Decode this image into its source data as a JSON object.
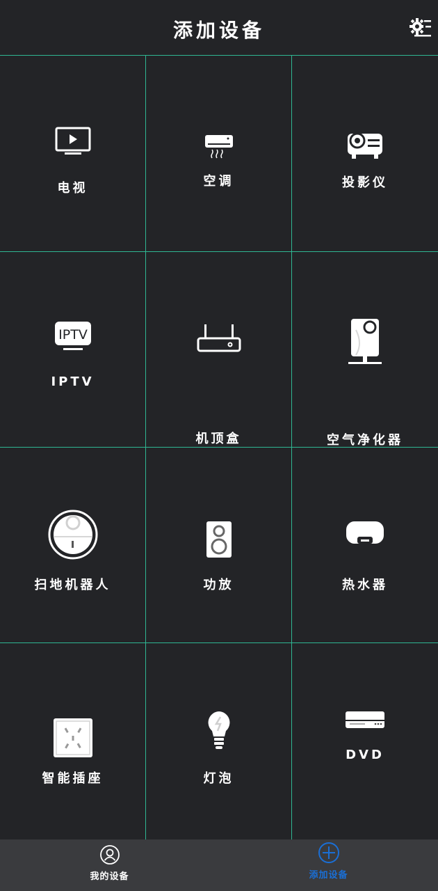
{
  "header": {
    "title": "添加设备",
    "settings_icon": "gear-list-icon"
  },
  "devices": [
    {
      "label": "电视",
      "icon": "tv-icon"
    },
    {
      "label": "空调",
      "icon": "air-conditioner-icon"
    },
    {
      "label": "投影仪",
      "icon": "projector-icon"
    },
    {
      "label": "IPTV",
      "icon": "iptv-icon"
    },
    {
      "label": "机顶盒",
      "icon": "set-top-box-icon"
    },
    {
      "label": "空气净化器",
      "icon": "air-purifier-icon"
    },
    {
      "label": "扫地机器人",
      "icon": "robot-vacuum-icon"
    },
    {
      "label": "功放",
      "icon": "speaker-icon"
    },
    {
      "label": "热水器",
      "icon": "water-heater-icon"
    },
    {
      "label": "智能插座",
      "icon": "smart-socket-icon"
    },
    {
      "label": "灯泡",
      "icon": "light-bulb-icon"
    },
    {
      "label": "DVD",
      "icon": "dvd-player-icon"
    }
  ],
  "tabbar": {
    "tabs": [
      {
        "label": "我的设备",
        "icon": "user-circle-icon",
        "color": "#ffffff"
      },
      {
        "label": "添加设备",
        "icon": "plus-circle-icon",
        "color": "#1a6fd6"
      }
    ]
  },
  "colors": {
    "background": "#232427",
    "grid_line": "#2fb893",
    "tabbar": "#3a3b3e",
    "active_tab": "#1a6fd6"
  }
}
